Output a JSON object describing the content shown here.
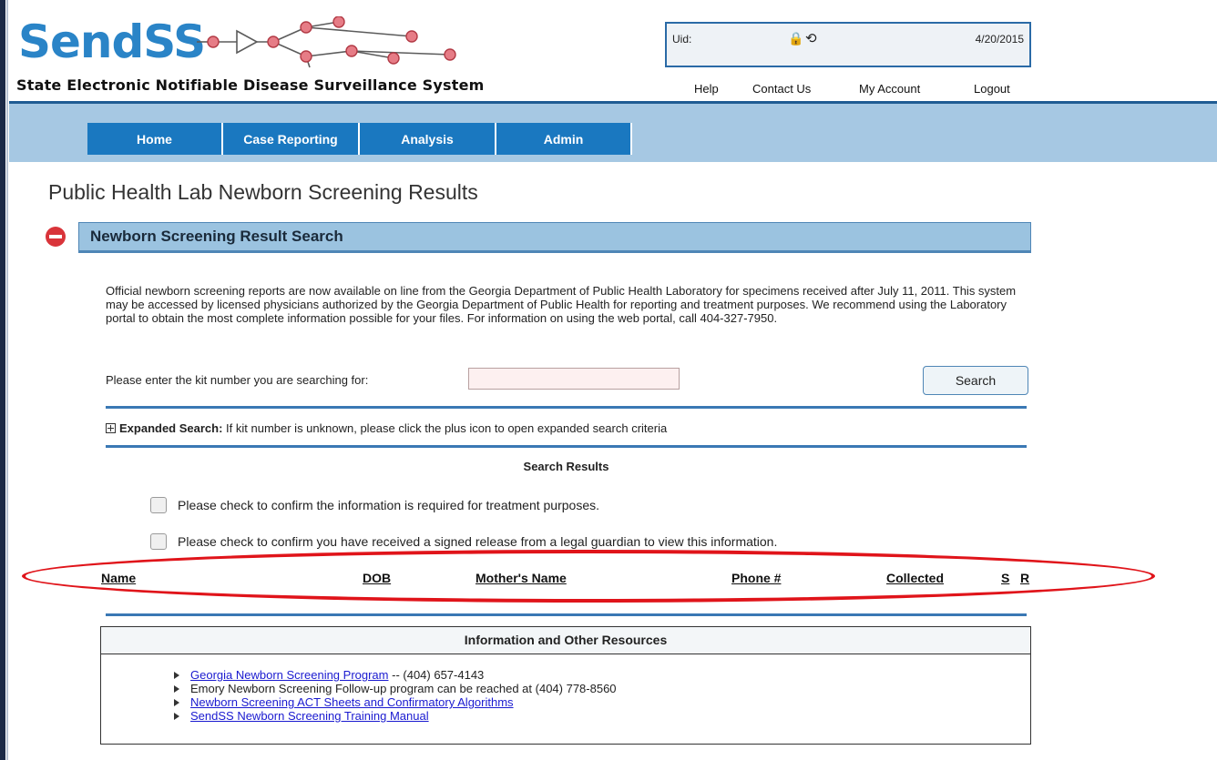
{
  "header": {
    "logo_text": "SendSS",
    "tagline": "State Electronic Notifiable Disease Surveillance System",
    "uid_label": "Uid:",
    "date": "4/20/2015",
    "links": {
      "help": "Help",
      "contact": "Contact Us",
      "account": "My Account",
      "logout": "Logout"
    },
    "icons": [
      "lock-icon",
      "refresh-icon"
    ]
  },
  "nav": {
    "home": "Home",
    "case_reporting": "Case Reporting",
    "analysis": "Analysis",
    "admin": "Admin"
  },
  "page_title": "Public Health Lab Newborn Screening Results",
  "section": {
    "title": "Newborn Screening Result Search",
    "intro": "Official newborn screening reports are now available on line from the Georgia Department of Public Health Laboratory for specimens received after July 11, 2011. This system may be accessed by licensed physicians authorized by the Georgia Department of Public Health for reporting and treatment purposes. We recommend using the Laboratory portal to obtain the most complete information possible for your files. For information on using the web portal, call 404-327-7950.",
    "kit_label": "Please enter the kit number you are searching for:",
    "kit_value": "",
    "search_button": "Search",
    "expanded_label": "Expanded Search:",
    "expanded_text": " If kit number is unknown, please click the plus icon to open expanded search criteria"
  },
  "results": {
    "title": "Search Results",
    "confirm_treatment": "Please check to confirm the information is required for treatment purposes.",
    "confirm_release": "Please check to confirm you have received a signed release from a legal guardian to view this information.",
    "columns": {
      "name": "Name",
      "dob": "DOB",
      "mother": "Mother's Name",
      "phone": "Phone #",
      "collected": "Collected",
      "s": "S",
      "r": "R"
    }
  },
  "resources": {
    "title": "Information and Other Resources",
    "items": [
      {
        "link": "Georgia Newborn Screening Program",
        "text": " -- (404) 657-4143"
      },
      {
        "text": "Emory Newborn Screening Follow-up program can be reached at (404) 778-8560"
      },
      {
        "link": "Newborn Screening ACT Sheets and Confirmatory Algorithms"
      },
      {
        "link": "SendSS Newborn Screening Training Manual"
      }
    ]
  },
  "colors": {
    "brand_blue": "#2a84c7",
    "nav_blue": "#1a78c0",
    "band_blue": "#a6c8e3",
    "highlight_red": "#e0141a"
  }
}
